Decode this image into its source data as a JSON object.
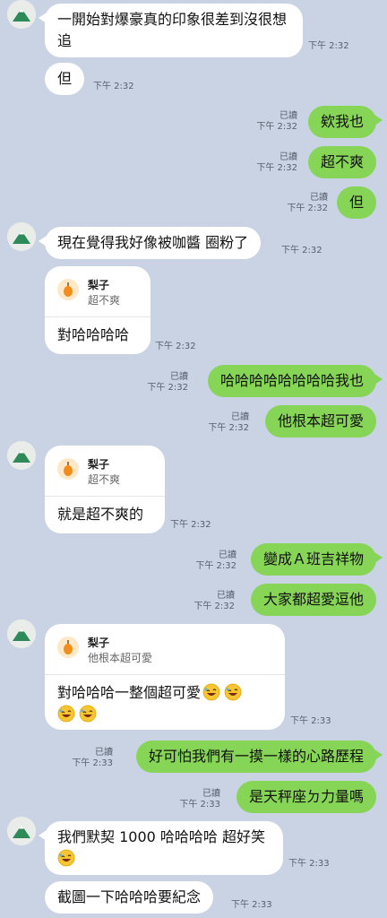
{
  "messages": {
    "m1": {
      "text": "一開始對爆豪真的印象很差到沒很想追",
      "time": "下午 2:32"
    },
    "m2": {
      "text": "但",
      "time": "下午 2:32"
    },
    "m3": {
      "text": "欸我也",
      "read": "已讀",
      "time": "下午 2:32"
    },
    "m4": {
      "text": "超不爽",
      "read": "已讀",
      "time": "下午 2:32"
    },
    "m5": {
      "text": "但",
      "read": "已讀",
      "time": "下午 2:32"
    },
    "m6": {
      "text": "現在覺得我好像被咖醬 圈粉了",
      "time": "下午 2:32"
    },
    "m7": {
      "reply_name": "梨子",
      "reply_quote": "超不爽",
      "text": "對哈哈哈哈",
      "time": "下午 2:32"
    },
    "m8": {
      "text": "哈哈哈哈哈哈哈哈我也",
      "read": "已讀",
      "time": "下午 2:32"
    },
    "m9": {
      "text": "他根本超可愛",
      "read": "已讀",
      "time": "下午 2:32"
    },
    "m10": {
      "reply_name": "梨子",
      "reply_quote": "超不爽",
      "text": "就是超不爽的",
      "time": "下午 2:32"
    },
    "m11": {
      "text": "變成Ａ班吉祥物",
      "read": "已讀",
      "time": "下午 2:32"
    },
    "m12": {
      "text": "大家都超愛逗他",
      "read": "已讀",
      "time": "下午 2:32"
    },
    "m13": {
      "reply_name": "梨子",
      "reply_quote": "他根本超可愛",
      "text": "對哈哈哈一整個超可愛",
      "time": "下午 2:33"
    },
    "m14": {
      "text": "好可怕我們有一摸一樣的心路歷程",
      "read": "已讀",
      "time": "下午 2:33"
    },
    "m15": {
      "text": "是天秤座ㄉ力量嗎",
      "read": "已讀",
      "time": "下午 2:33"
    },
    "m16": {
      "text": "我們默契 1000 哈哈哈哈 超好笑",
      "time": "下午 2:33"
    },
    "m17": {
      "text": "截圖一下哈哈哈要紀念",
      "time": "下午 2:33"
    }
  },
  "colors": {
    "background": "#c9d3e3",
    "outgoing": "#86d556",
    "incoming": "#ffffff"
  },
  "icons": {
    "avatar": "mountain-avatar-icon",
    "reply": "pear-icon",
    "emoji": "rofl-emoji-icon"
  }
}
